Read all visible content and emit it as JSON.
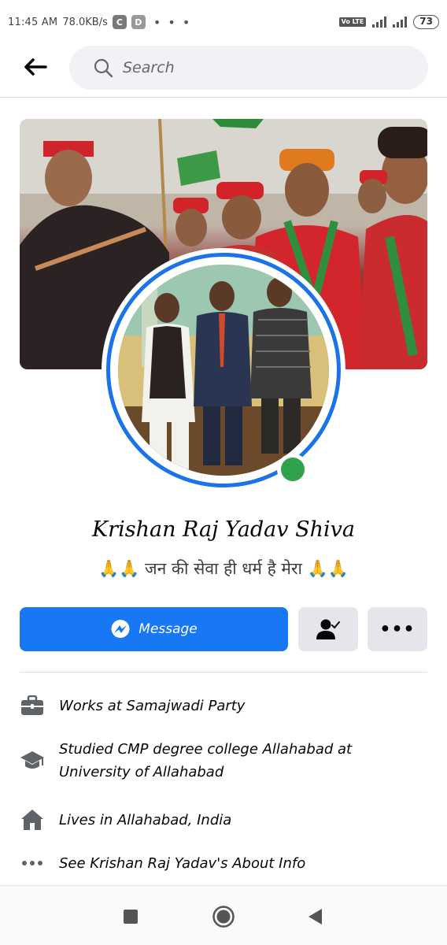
{
  "status_bar": {
    "time": "11:45 AM",
    "speed": "78.0KB/s",
    "app_icon_1": "C",
    "app_icon_2": "D",
    "more_dots": "• • •",
    "volte": "Vo LTE",
    "battery": "73"
  },
  "header": {
    "back_icon": "arrow-left-icon",
    "search_placeholder": "Search"
  },
  "profile": {
    "name": "Krishan Raj Yadav Shiva",
    "bio_prefix": "🙏🙏",
    "bio_text": "जन की सेवा ही धर्म है मेरा",
    "bio_suffix": "🙏🙏",
    "online": true
  },
  "actions": {
    "message_label": "Message",
    "friend_icon": "friend-check-icon",
    "more_label": "•••"
  },
  "info": {
    "work": "Works at Samajwadi Party",
    "education": "Studied CMP degree college Allahabad at University of Allahabad",
    "lives": "Lives in Allahabad, India",
    "about": "See Krishan Raj Yadav's About Info"
  },
  "colors": {
    "accent": "#1877f2",
    "online": "#31a24c",
    "avatar_ring": "#1a73e8"
  }
}
